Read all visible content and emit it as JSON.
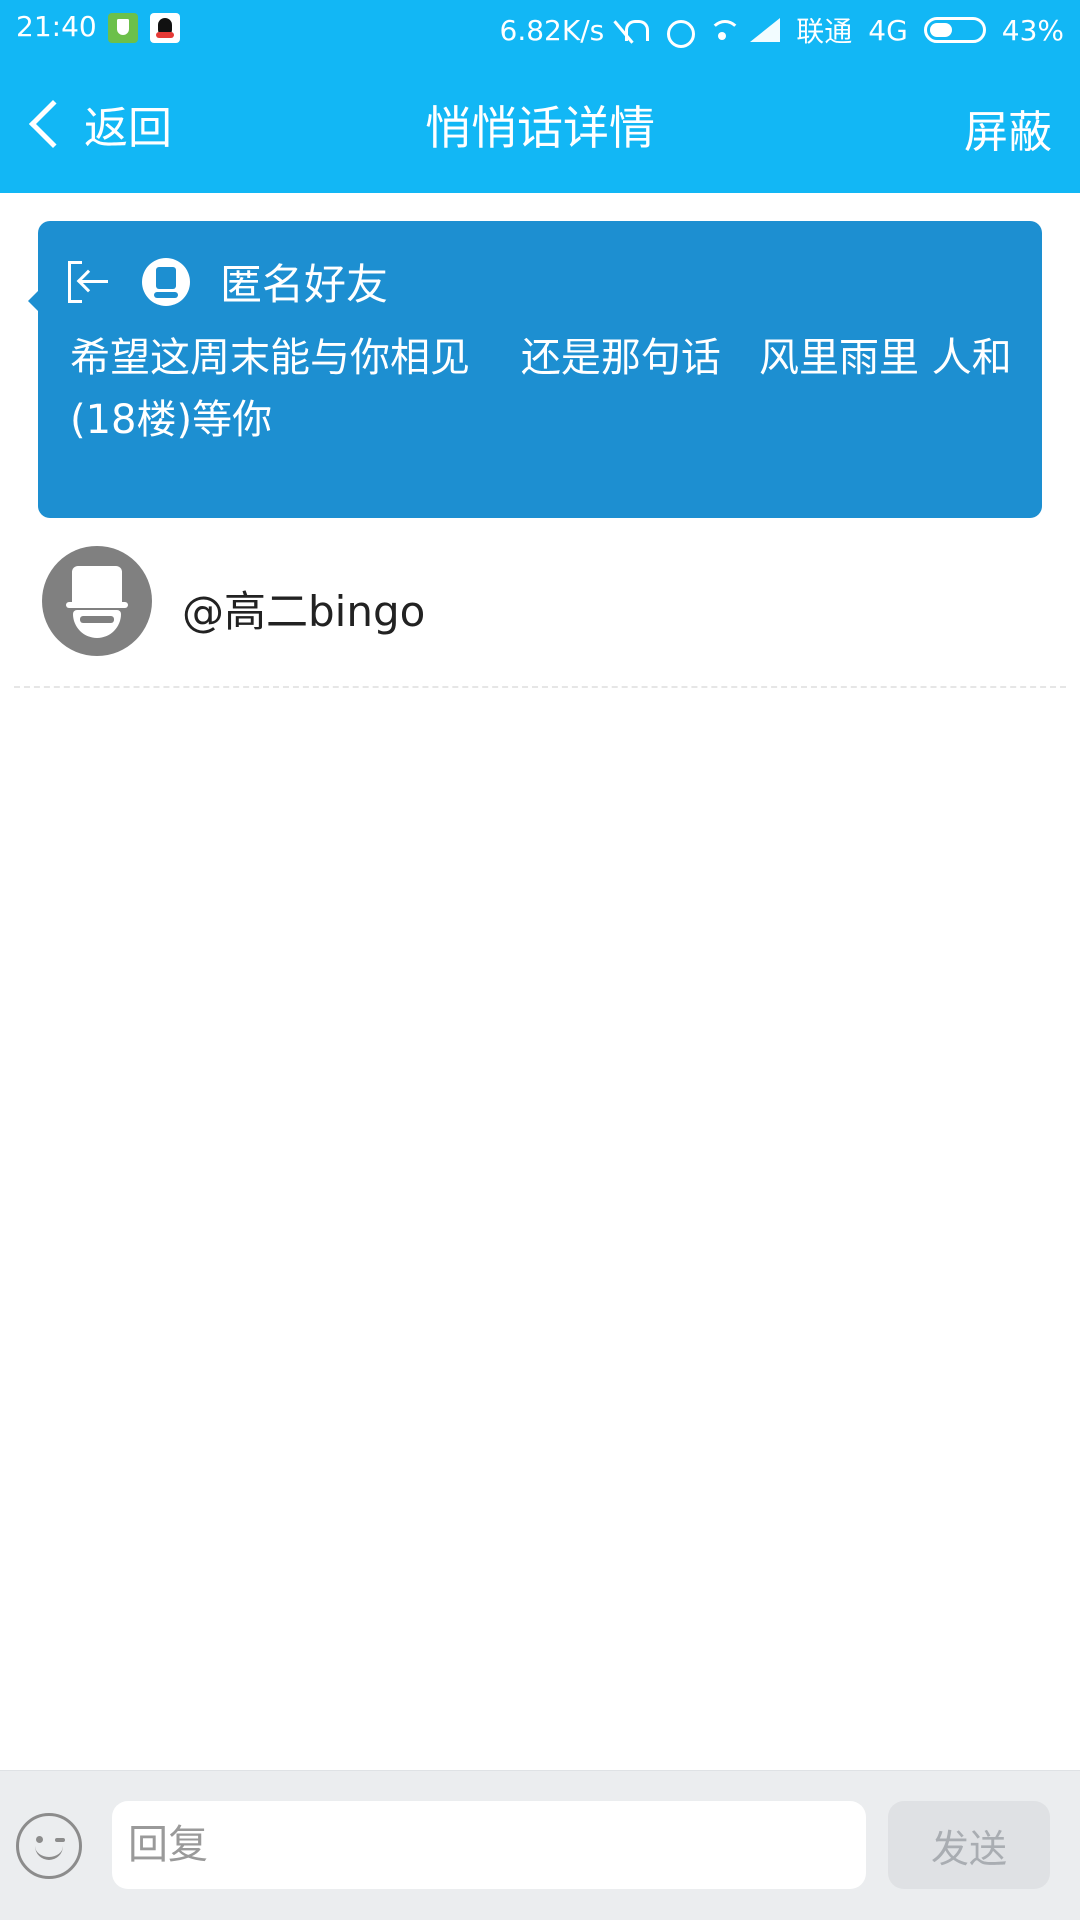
{
  "status_bar": {
    "time": "21:40",
    "speed": "6.82K/s",
    "carrier": "联通",
    "network": "4G",
    "battery": "43%",
    "battery_level": 0.43
  },
  "nav": {
    "back_label": "返回",
    "title": "悄悄话详情",
    "action_label": "屏蔽"
  },
  "message": {
    "sender": "匿名好友",
    "text": "希望这周末能与你相见    还是那句话   风里雨里 人和(18楼)等你"
  },
  "recipient": {
    "name": "@高二bingo"
  },
  "composer": {
    "placeholder": "回复",
    "send_label": "发送"
  },
  "colors": {
    "nav_bar": "#12b7f5",
    "message_card": "#1d8fd1"
  }
}
